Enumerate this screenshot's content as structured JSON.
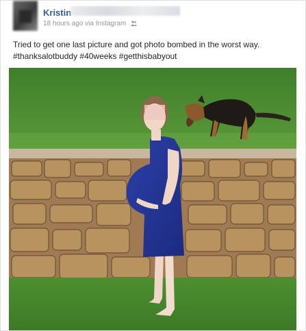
{
  "post": {
    "author": "Kristin",
    "timestamp": "18 hours ago",
    "via": "via Instagram",
    "audience_icon": "friends-icon",
    "text_line1": "Tried to get one last picture and got photo bombed in the worst way.",
    "hashtags": "#thanksalotbuddy #40weeks #getthisbabyout"
  },
  "colors": {
    "link": "#365899",
    "meta": "#90949c",
    "text": "#1d2129",
    "border": "#dddfe2"
  }
}
